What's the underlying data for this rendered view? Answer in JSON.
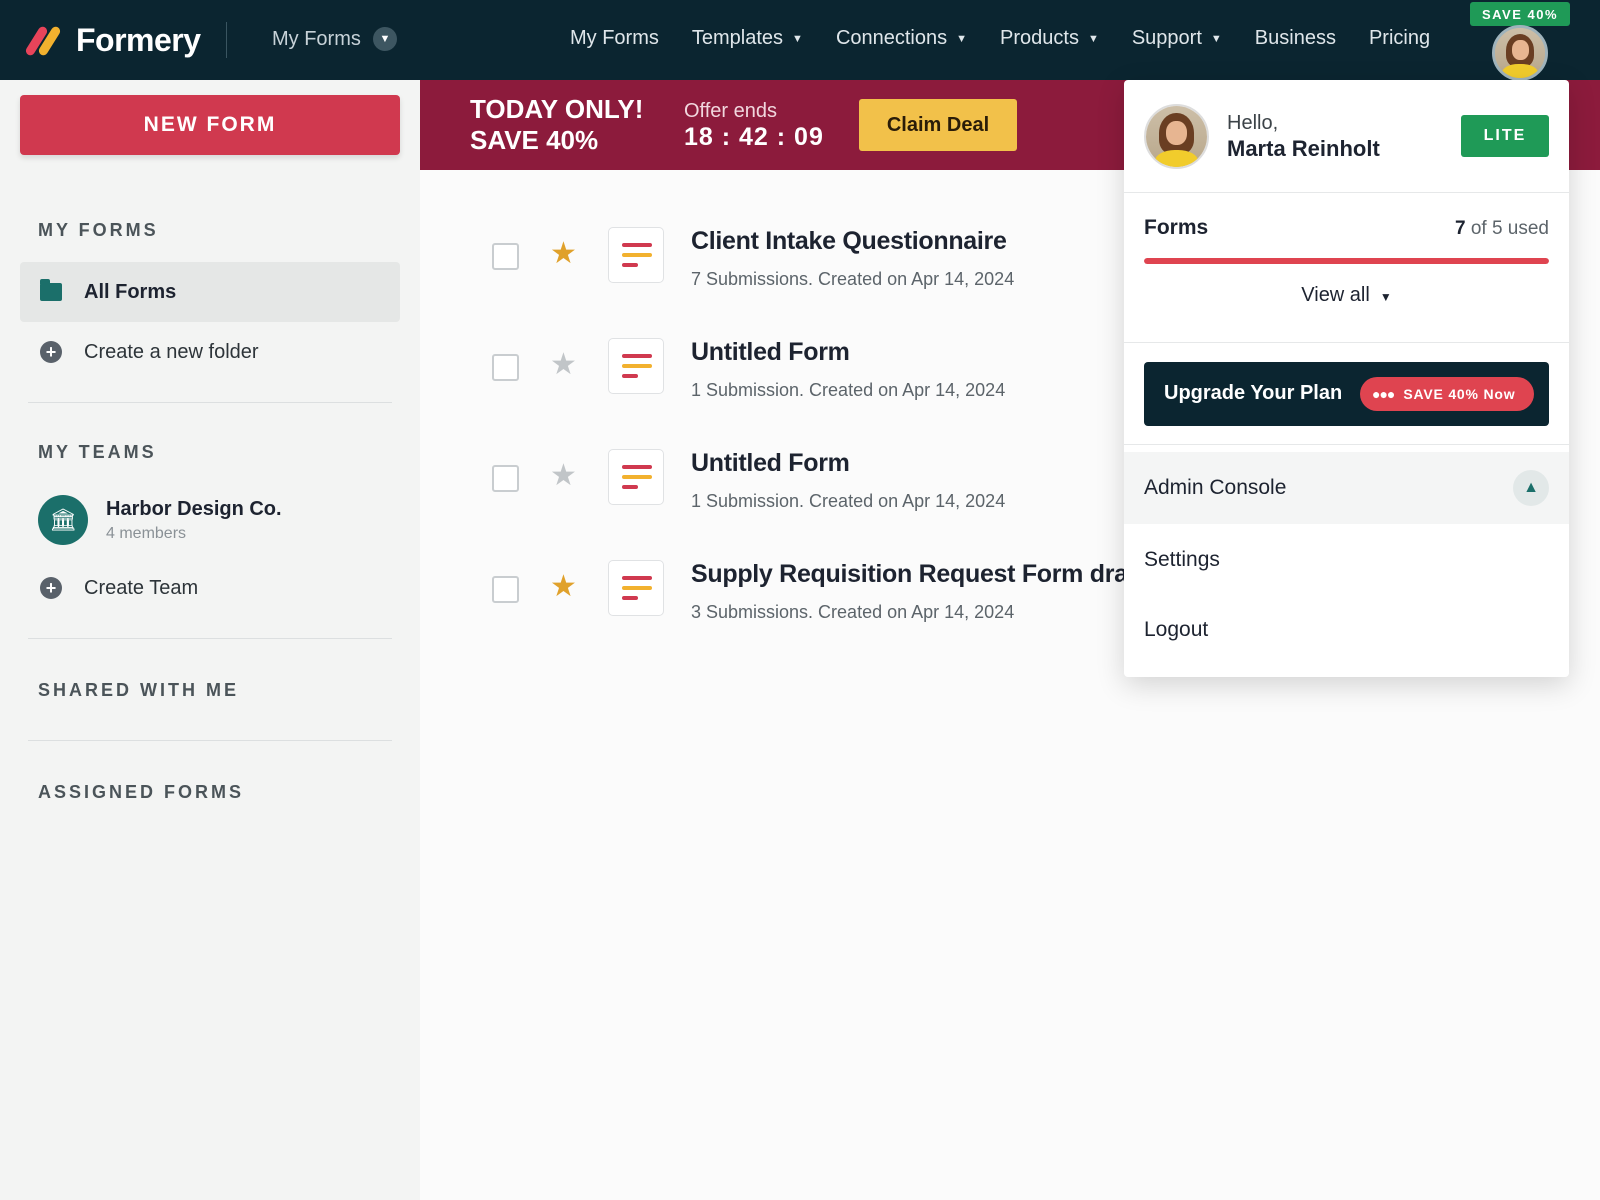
{
  "app": {
    "logo_text": "Formery",
    "switcher_label": "My Forms"
  },
  "nav": {
    "links": [
      {
        "label": "My Forms",
        "has_dropdown": false
      },
      {
        "label": "Templates",
        "has_dropdown": true
      },
      {
        "label": "Connections",
        "has_dropdown": true
      },
      {
        "label": "Products",
        "has_dropdown": true
      },
      {
        "label": "Support",
        "has_dropdown": true
      },
      {
        "label": "Business",
        "has_dropdown": false
      },
      {
        "label": "Pricing",
        "has_dropdown": false
      }
    ],
    "save_badge": "SAVE 40%"
  },
  "sidebar": {
    "new_form_label": "NEW FORM",
    "my_forms_title": "MY FORMS",
    "all_forms_label": "All Forms",
    "create_folder_label": "Create a new folder",
    "my_teams_title": "MY TEAMS",
    "team": {
      "name": "Harbor Design Co.",
      "members": "4 members"
    },
    "create_team_label": "Create Team",
    "shared_title": "SHARED WITH ME",
    "assigned_title": "ASSIGNED FORMS"
  },
  "promo": {
    "title_line1": "TODAY ONLY!",
    "title_line2": "SAVE 40%",
    "offer_label": "Offer ends",
    "timer": "18 : 42 : 09",
    "claim_label": "Claim Deal"
  },
  "forms": [
    {
      "title": "Client Intake Questionnaire",
      "meta": "7 Submissions. Created on Apr 14, 2024",
      "starred": true
    },
    {
      "title": "Untitled Form",
      "meta": "1 Submission. Created on Apr 14, 2024",
      "starred": false
    },
    {
      "title": "Untitled Form",
      "meta": "1 Submission. Created on Apr 14, 2024",
      "starred": false
    },
    {
      "title": "Supply Requisition Request Form draft",
      "meta": "3 Submissions. Created on Apr 14, 2024",
      "starred": true
    }
  ],
  "account_menu": {
    "hello": "Hello,",
    "name": "Marta Reinholt",
    "plan_badge": "LITE",
    "usage_label": "Forms",
    "usage_used": "7",
    "usage_text": "of 5 used",
    "usage_fraction": 1.0,
    "view_all_label": "View all",
    "upgrade_label": "Upgrade Your Plan",
    "upgrade_pill": "SAVE 40% Now",
    "items": [
      "Admin Console",
      "Settings",
      "Logout"
    ]
  },
  "colors": {
    "nav_bg": "#0b2530",
    "accent_red": "#d0394f",
    "promo_bg": "#8c1b3c",
    "claim_yellow": "#f2c14a",
    "green": "#1f9a57",
    "star_on": "#e0a12b"
  }
}
